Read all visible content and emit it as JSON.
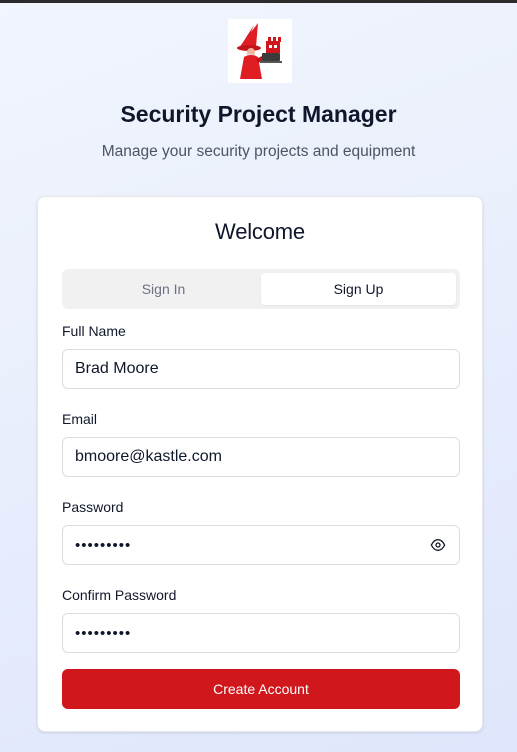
{
  "app": {
    "logo_icon": "wizard-mascot-icon",
    "title": "Security Project Manager",
    "subtitle": "Manage your security projects and equipment"
  },
  "card": {
    "title": "Welcome",
    "tabs": [
      {
        "label": "Sign In",
        "active": false
      },
      {
        "label": "Sign Up",
        "active": true
      }
    ]
  },
  "form": {
    "full_name": {
      "label": "Full Name",
      "value": "Brad Moore"
    },
    "email": {
      "label": "Email",
      "value": "bmoore@kastle.com"
    },
    "password": {
      "label": "Password",
      "value": "•••••••••",
      "toggle_icon": "eye-icon"
    },
    "confirm_password": {
      "label": "Confirm Password",
      "value": "•••••••••"
    },
    "submit_label": "Create Account"
  },
  "colors": {
    "accent": "#d0171c",
    "background": "#e8eefc",
    "text": "#0f172a",
    "muted": "#4b5563"
  }
}
